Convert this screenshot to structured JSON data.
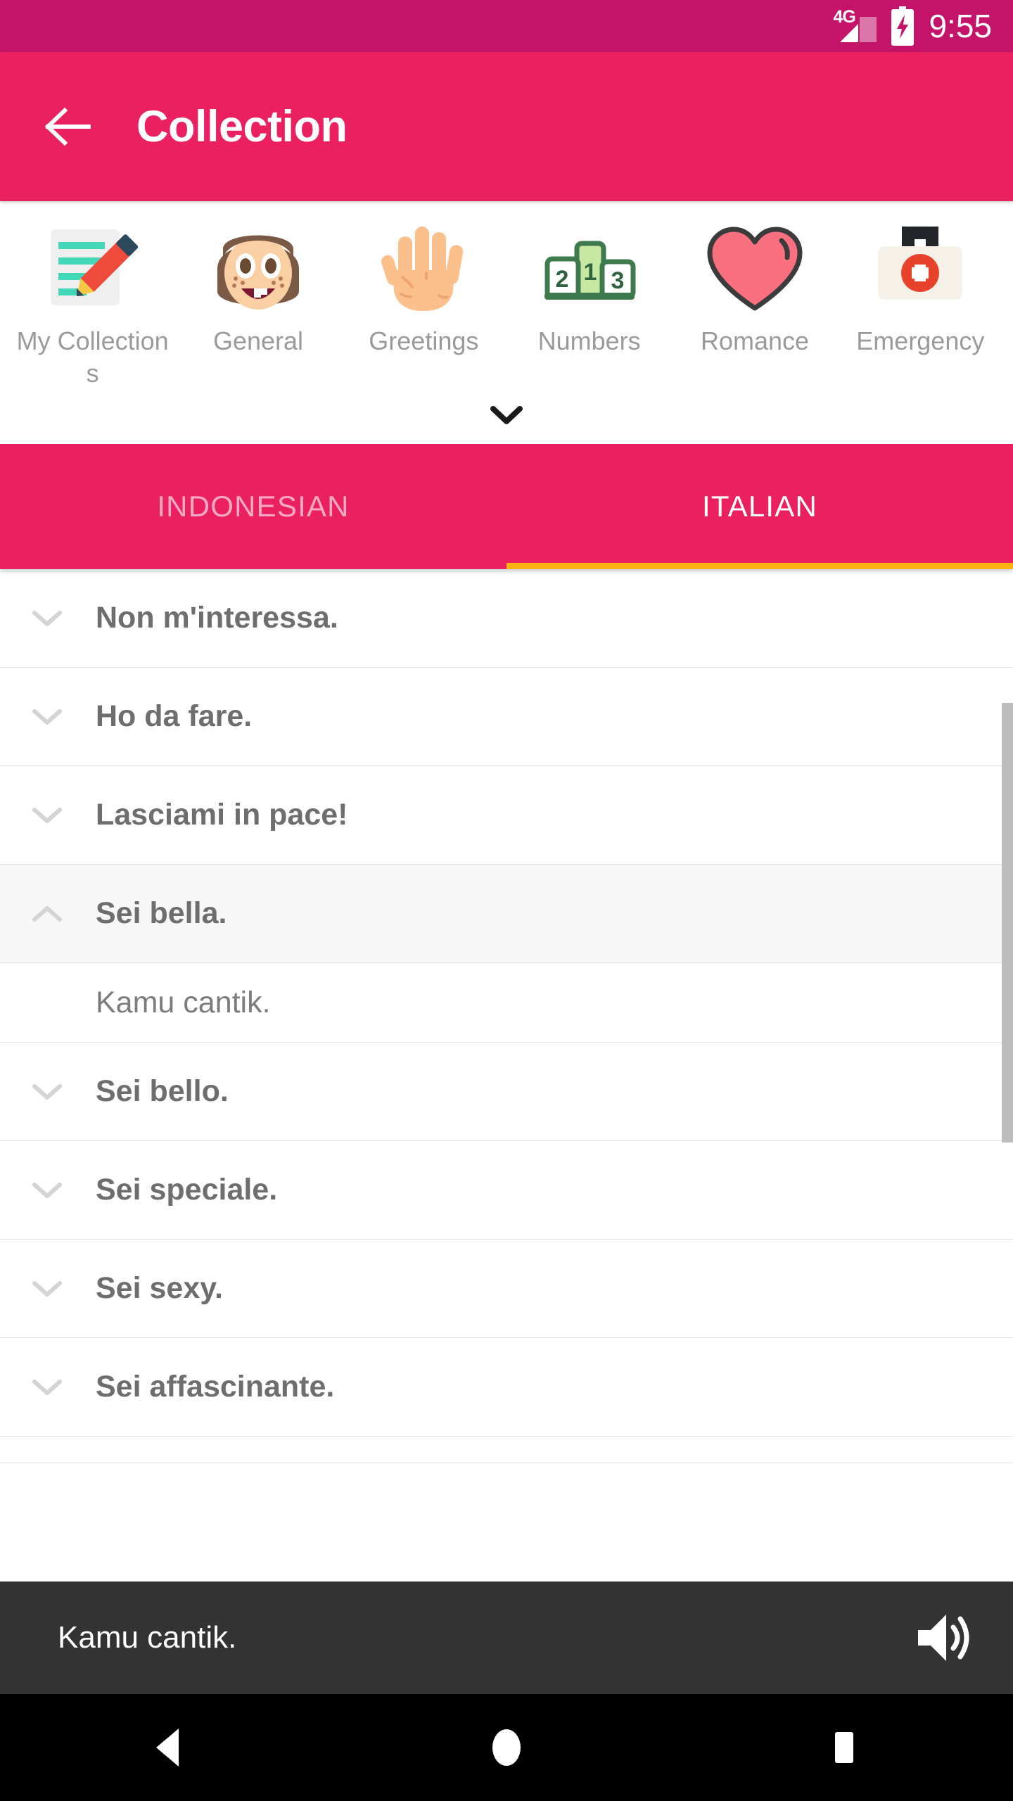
{
  "status_bar": {
    "network": "4G",
    "time": "9:55",
    "battery_icon": "battery-charging-icon",
    "signal_icon": "signal-bars-icon"
  },
  "app_bar": {
    "back_icon": "back-arrow-icon",
    "title": "Collection"
  },
  "categories": {
    "expand_icon": "chevron-down-icon",
    "items": [
      {
        "label": "My Collections",
        "icon": "memo-pencil-icon"
      },
      {
        "label": "General",
        "icon": "girl-face-icon"
      },
      {
        "label": "Greetings",
        "icon": "open-hand-icon"
      },
      {
        "label": "Numbers",
        "icon": "podium-icon"
      },
      {
        "label": "Romance",
        "icon": "heart-icon"
      },
      {
        "label": "Emergency",
        "icon": "first-aid-kit-icon"
      }
    ]
  },
  "tabs": {
    "items": [
      {
        "label": "INDONESIAN",
        "active": false
      },
      {
        "label": "ITALIAN",
        "active": true
      }
    ],
    "indicator_color": "#FCB316"
  },
  "phrases": [
    {
      "text": "Non m'interessa.",
      "expanded": false
    },
    {
      "text": "Ho da fare.",
      "expanded": false
    },
    {
      "text": "Lasciami in pace!",
      "expanded": false
    },
    {
      "text": "Sei bella.",
      "expanded": true,
      "translation": "Kamu cantik."
    },
    {
      "text": "Sei bello.",
      "expanded": false
    },
    {
      "text": "Sei speciale.",
      "expanded": false
    },
    {
      "text": "Sei sexy.",
      "expanded": false
    },
    {
      "text": "Sei affascinante.",
      "expanded": false
    }
  ],
  "playback_bar": {
    "text": "Kamu cantik.",
    "speaker_icon": "volume-up-icon"
  },
  "nav_bar": {
    "back_icon": "nav-back-triangle-icon",
    "home_icon": "nav-home-circle-icon",
    "recents_icon": "nav-recents-square-icon"
  },
  "colors": {
    "status_bar": "#C4146A",
    "primary": "#EA2061",
    "accent": "#FCB316",
    "playbar": "#333333",
    "navbar": "#000000"
  }
}
